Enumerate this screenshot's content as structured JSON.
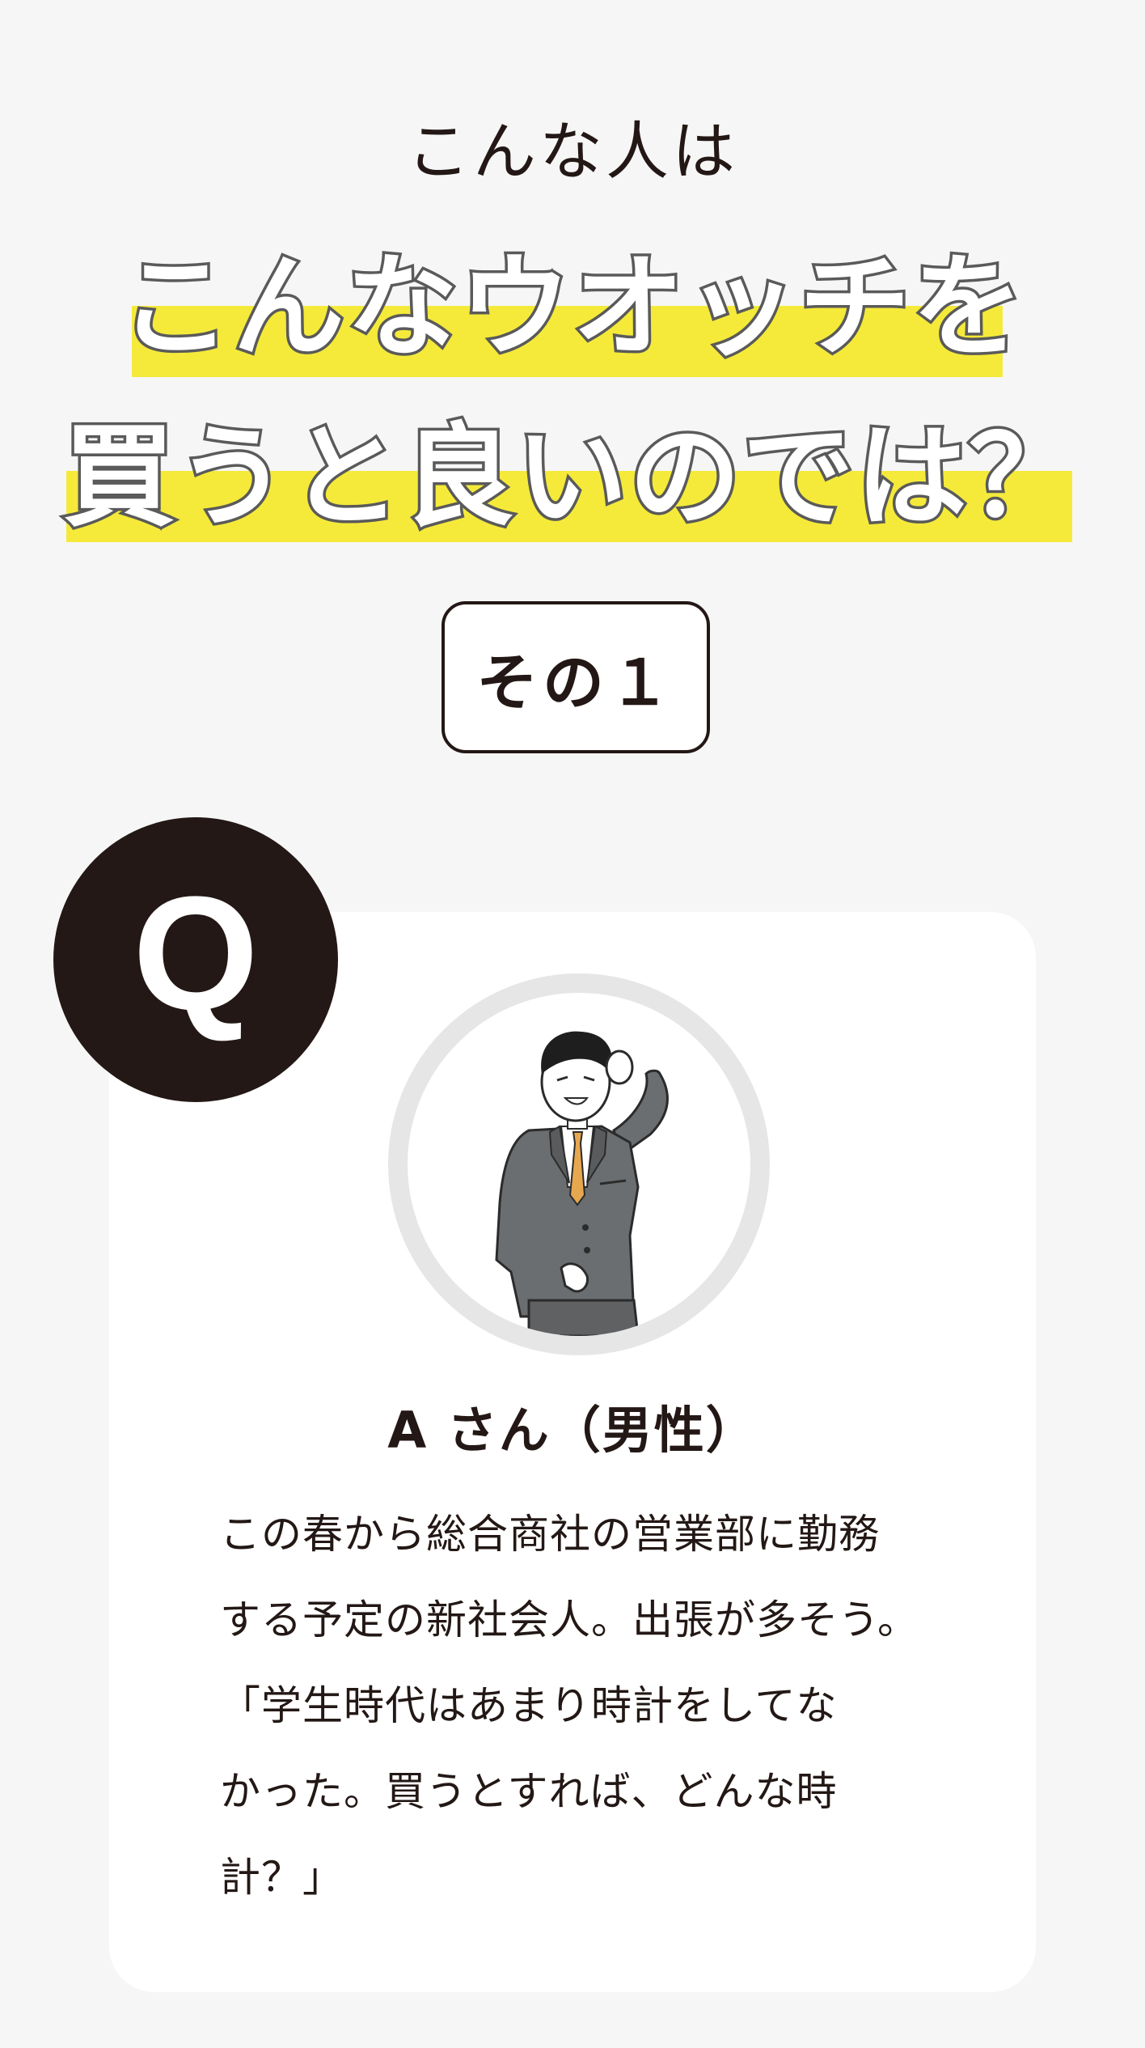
{
  "header": {
    "subtitle": "こんな人は",
    "headline_line1": "こんなウオッチを",
    "headline_line2": "買うと良いのでは？",
    "highlight_color": "#f5ea3a"
  },
  "badge": {
    "label": "その１"
  },
  "question": {
    "mark": "Q",
    "person_name": "A さん（男性）",
    "description_lines": [
      "この春から総合商社の営業部に勤務",
      "する予定の新社会人。出張が多そう。",
      "「学生時代はあまり時計をしてな",
      "かった。買うとすれば、どんな時",
      "計？」"
    ]
  }
}
